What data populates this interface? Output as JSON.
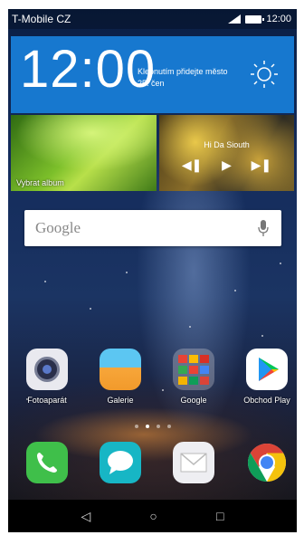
{
  "status_bar": {
    "carrier": "T-Mobile CZ",
    "time": "12:00"
  },
  "clock_widget": {
    "time": "12:00",
    "hint": "Klepnutím přidejte město",
    "date": "25. čen",
    "weather_icon": "sun-icon"
  },
  "album_widget": {
    "label": "Vybrat album"
  },
  "music_widget": {
    "title": "Hi Da Siouth",
    "controls": [
      "previous-icon",
      "play-icon",
      "next-icon"
    ]
  },
  "search": {
    "logo": "Google",
    "icon": "mic-icon"
  },
  "apps": [
    {
      "label": "Fotoaparát",
      "icon": "camera-icon"
    },
    {
      "label": "Galerie",
      "icon": "gallery-icon"
    },
    {
      "label": "Google",
      "icon": "google-folder-icon"
    },
    {
      "label": "Obchod Play",
      "icon": "play-store-icon"
    }
  ],
  "page_indicator": {
    "pages": 4,
    "active": 1
  },
  "dock": [
    {
      "icon": "phone-icon"
    },
    {
      "icon": "messages-icon"
    },
    {
      "icon": "email-icon"
    },
    {
      "icon": "chrome-icon"
    }
  ],
  "navbar": {
    "buttons": [
      "back-icon",
      "home-icon",
      "recents-icon"
    ]
  },
  "colors": {
    "clock_widget_bg": "#1778cf",
    "nav_bg": "#000000"
  }
}
